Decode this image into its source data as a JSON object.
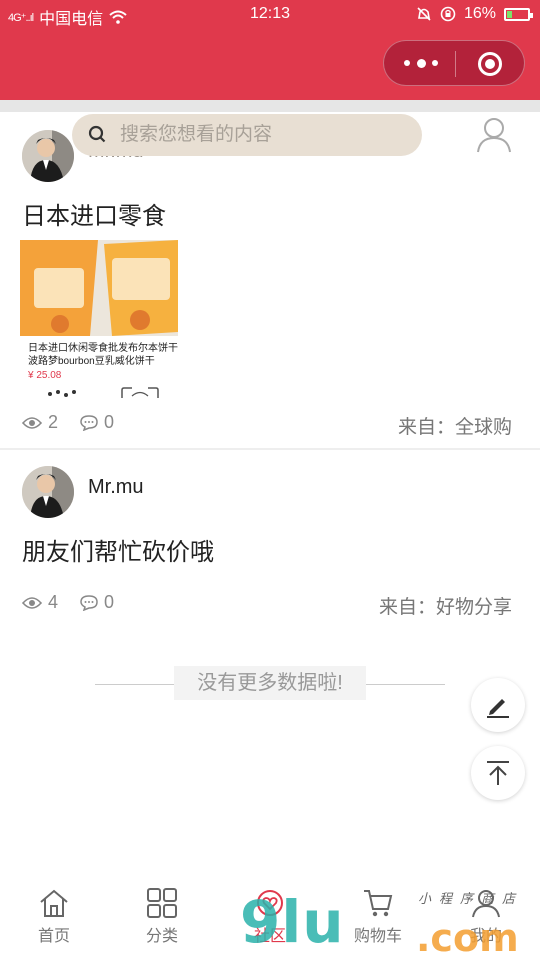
{
  "status_bar": {
    "signal": "4G⁺..ıl",
    "carrier": "中国电信",
    "time": "12:13",
    "battery": "16%"
  },
  "search": {
    "placeholder": "搜索您想看的内容"
  },
  "posts": [
    {
      "author": "Mr.mu",
      "title": "日本进口零食",
      "goods": {
        "name": "日本进口休闲零食批发布尔本饼干波路梦bourbon豆乳威化饼干",
        "price": "¥ 25.08"
      },
      "views": "2",
      "comments": "0",
      "source": "来自：全球购"
    },
    {
      "author": "Mr.mu",
      "title": "朋友们帮忙砍价哦",
      "views": "4",
      "comments": "0",
      "source": "来自：好物分享"
    }
  ],
  "no_more": "没有更多数据啦!",
  "tabs": [
    {
      "label": "首页",
      "icon": "home-icon"
    },
    {
      "label": "分类",
      "icon": "grid-icon"
    },
    {
      "label": "社区",
      "icon": "community-icon"
    },
    {
      "label": "购物车",
      "icon": "cart-icon"
    },
    {
      "label": "我的",
      "icon": "user-icon"
    }
  ],
  "watermark": {
    "digits": "9lu",
    "suffix": ".com",
    "chinese": "小程序商店"
  },
  "colors": {
    "brand": "#e0394c",
    "search_bg": "#e8dfd3"
  }
}
